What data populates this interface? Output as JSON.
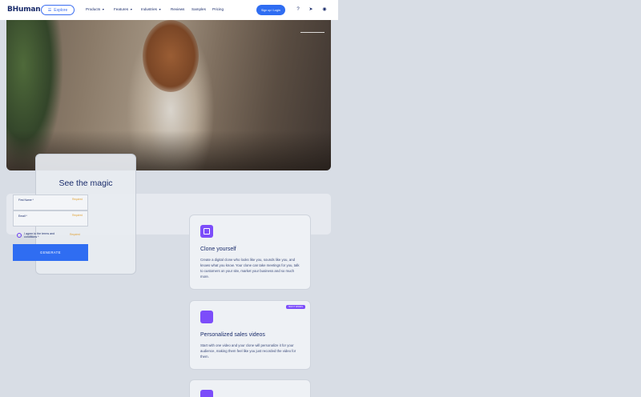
{
  "nav": {
    "logo": "BHuman",
    "explore": "Explore",
    "menu": [
      "Products",
      "Features",
      "Industries",
      "Reviews",
      "Samples",
      "Pricing"
    ],
    "signin": "Sign up / Login"
  },
  "form": {
    "title": "See the magic",
    "first_name_label": "First Name *",
    "email_label": "Email *",
    "required": "Required",
    "terms_label": "I agree to the terms and conditions *",
    "generate": "GENERATE"
  },
  "cards": [
    {
      "title": "Clone yourself",
      "body": "Create a digital clone who looks like you, sounds like you, and knows what you know. Your clone can take meetings for you, talk to customers on your site, market your business and so much more.",
      "badge": ""
    },
    {
      "title": "Personalized sales videos",
      "body": "Start with one video and your clone will personalize it for your audience, making them feel like you just recorded the video for them.",
      "badge": "HOW IT WORKS"
    },
    {
      "title": "",
      "body": "",
      "badge": ""
    }
  ],
  "colors": {
    "brand": "#1a2c6b",
    "accent": "#2f6df2",
    "purple": "#7c4dfa"
  }
}
